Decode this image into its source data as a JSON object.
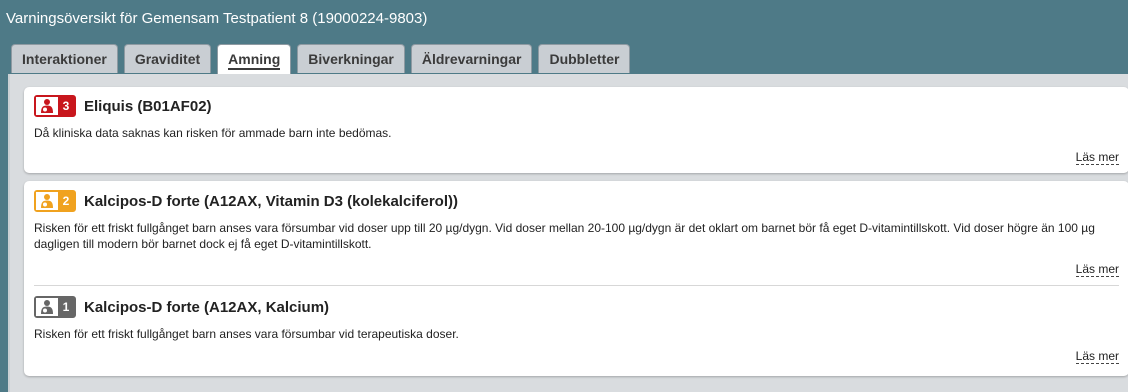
{
  "window": {
    "title": "Varningsöversikt för Gemensam Testpatient 8 (19000224-9803)"
  },
  "tabs": [
    {
      "label": "Interaktioner",
      "active": false
    },
    {
      "label": "Graviditet",
      "active": false
    },
    {
      "label": "Amning",
      "active": true
    },
    {
      "label": "Biverkningar",
      "active": false
    },
    {
      "label": "Äldrevarningar",
      "active": false
    },
    {
      "label": "Dubbletter",
      "active": false
    }
  ],
  "warnings": [
    {
      "level": "3",
      "color": "#c8161d",
      "title": "Eliquis (B01AF02)",
      "description": "Då kliniska data saknas kan risken för ammade barn inte bedömas.",
      "read_more": "Läs mer"
    },
    {
      "level": "2",
      "color": "#f0a21f",
      "title": "Kalcipos-D forte (A12AX, Vitamin D3 (kolekalciferol))",
      "description": "Risken för ett friskt fullgånget barn anses vara försumbar vid doser upp till 20 µg/dygn. Vid doser mellan 20-100 µg/dygn är det oklart om barnet bör få eget D-vitamintillskott. Vid doser högre än 100 µg dagligen till modern bör barnet dock ej få eget D-vitamintillskott.",
      "read_more": "Läs mer"
    },
    {
      "level": "1",
      "color": "#666666",
      "title": "Kalcipos-D forte (A12AX, Kalcium)",
      "description": "Risken för ett friskt fullgånget barn anses vara försumbar vid terapeutiska doser.",
      "read_more": "Läs mer"
    }
  ]
}
